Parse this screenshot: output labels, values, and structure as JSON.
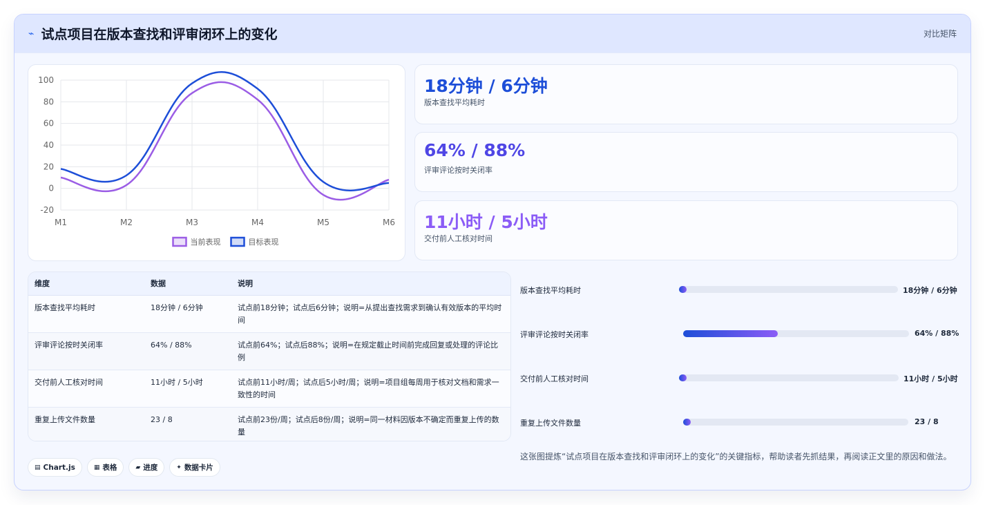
{
  "header": {
    "icon": "line-chart-icon",
    "title": "试点项目在版本查找和评审闭环上的变化",
    "right": "对比矩阵"
  },
  "chart_data": {
    "type": "line",
    "categories": [
      "M1",
      "M2",
      "M3",
      "M4",
      "M5",
      "M6"
    ],
    "series": [
      {
        "name": "当前表现",
        "values": [
          10,
          3,
          88,
          82,
          -6,
          8
        ],
        "color": "#9b5de5"
      },
      {
        "name": "目标表现",
        "values": [
          18,
          12,
          97,
          92,
          6,
          5
        ],
        "color": "#1d4ed8"
      }
    ],
    "ylim": [
      -20,
      100
    ],
    "yticks": [
      "100",
      "80",
      "60",
      "40",
      "20",
      "0",
      "-20"
    ],
    "grid": true,
    "legend": "bottom"
  },
  "kpis": [
    {
      "value": "18分钟 / 6分钟",
      "label": "版本查找平均耗时",
      "color": "#1d4ed8"
    },
    {
      "value": "64% / 88%",
      "label": "评审评论按时关闭率",
      "color": "#4f46e5"
    },
    {
      "value": "11小时 / 5小时",
      "label": "交付前人工核对时间",
      "color": "#8b5cf6"
    }
  ],
  "table": {
    "headers": [
      "维度",
      "数据",
      "说明"
    ],
    "rows": [
      [
        "版本查找平均耗时",
        "18分钟 / 6分钟",
        "试点前18分钟；试点后6分钟；说明=从提出查找需求到确认有效版本的平均时间"
      ],
      [
        "评审评论按时关闭率",
        "64% / 88%",
        "试点前64%；试点后88%；说明=在规定截止时间前完成回复或处理的评论比例"
      ],
      [
        "交付前人工核对时间",
        "11小时 / 5小时",
        "试点前11小时/周；试点后5小时/周；说明=项目组每周用于核对文档和需求一致性的时间"
      ],
      [
        "重复上传文件数量",
        "23 / 8",
        "试点前23份/周；试点后8份/周；说明=同一材料因版本不确定而重复上传的数量"
      ]
    ]
  },
  "progress": [
    {
      "label": "版本查找平均耗时",
      "value": "18分钟 / 6分钟",
      "fill": 0.02
    },
    {
      "label": "评审评论按时关闭率",
      "value": "64% / 88%",
      "fill": 0.42
    },
    {
      "label": "交付前人工核对时间",
      "value": "11小时 / 5小时",
      "fill": 0.02
    },
    {
      "label": "重复上传文件数量",
      "value": "23 / 8",
      "fill": 0.02
    }
  ],
  "tags": [
    {
      "icon": "chart-icon",
      "label": "Chart.js"
    },
    {
      "icon": "table-icon",
      "label": "表格"
    },
    {
      "icon": "progress-icon",
      "label": "进度"
    },
    {
      "icon": "sparkle-icon",
      "label": "数据卡片"
    }
  ],
  "note": "这张图提炼“试点项目在版本查找和评审闭环上的变化”的关键指标，帮助读者先抓结果，再阅读正文里的原因和做法。"
}
